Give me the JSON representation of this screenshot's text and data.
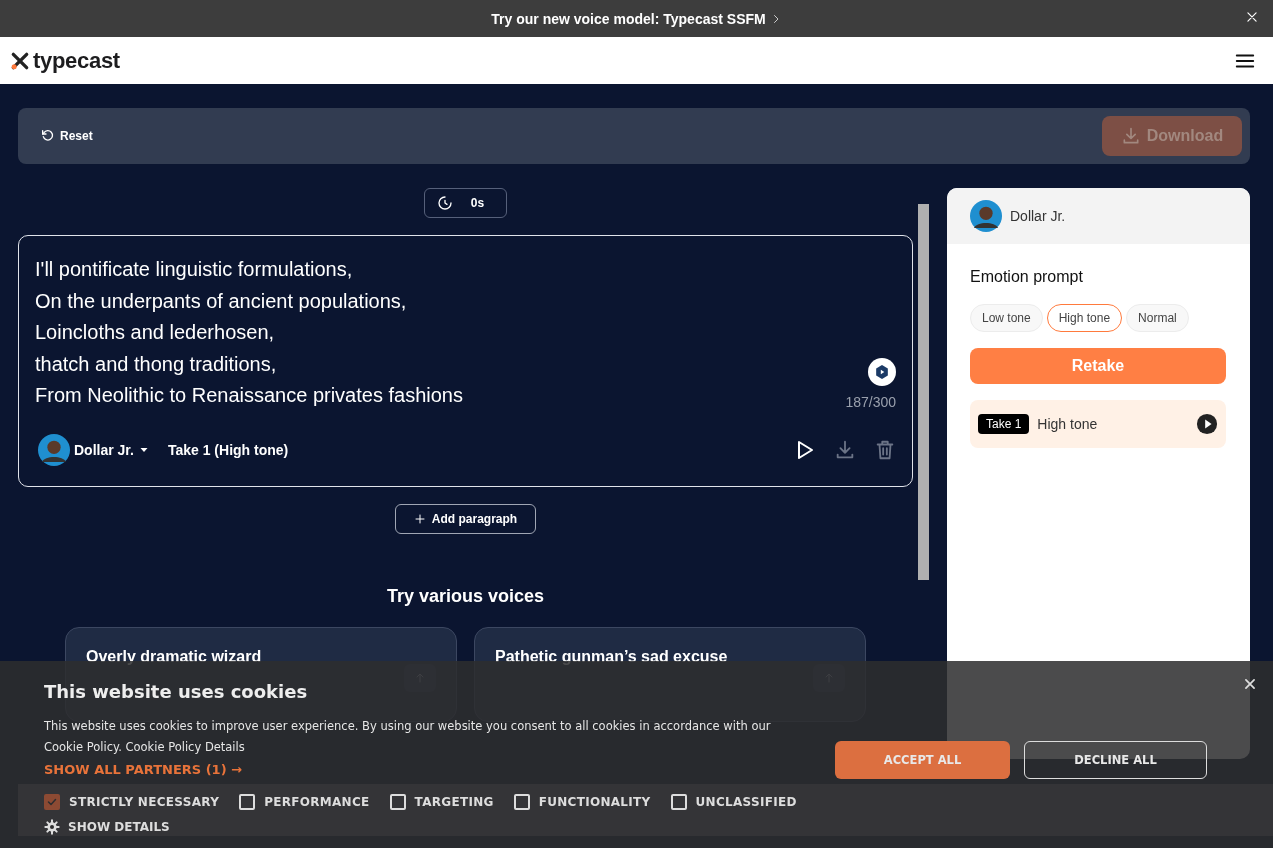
{
  "banner": {
    "text": "Try our new voice model: Typecast SSFM"
  },
  "header": {
    "logo": "typecast"
  },
  "toolbar": {
    "reset": "Reset",
    "download": {
      "label": "Download",
      "disabled": true
    }
  },
  "editor": {
    "timer": "0s",
    "lines": [
      "I'll pontificate linguistic formulations,",
      "On the underpants of ancient populations,",
      "Loincloths and lederhosen,",
      "thatch and thong traditions,",
      "From Neolithic to Renaissance privates fashions"
    ],
    "counter": "187/300",
    "voice": "Dollar Jr.",
    "take": "Take 1 (High tone)"
  },
  "add_paragraph": "Add paragraph",
  "voices": {
    "title": "Try various voices",
    "cards": [
      {
        "title": "Overly dramatic wizard"
      },
      {
        "title": "Pathetic gunman’s sad excuse"
      }
    ]
  },
  "side_panel": {
    "voice": "Dollar Jr.",
    "emotion_title": "Emotion prompt",
    "emotions": [
      {
        "label": "Low tone",
        "selected": false
      },
      {
        "label": "High tone",
        "selected": true
      },
      {
        "label": "Normal",
        "selected": false
      }
    ],
    "retake": "Retake",
    "takes": [
      {
        "badge": "Take 1",
        "label": "High tone"
      }
    ]
  },
  "cookies": {
    "title": "This website uses cookies",
    "body": "This website uses cookies to improve user experience. By using our website you consent to all cookies in accordance with our Cookie Policy.",
    "details_link": "Cookie Policy Details",
    "partners": "SHOW ALL PARTNERS (1) →",
    "accept": "ACCEPT ALL",
    "decline": "DECLINE ALL",
    "categories": [
      {
        "label": "STRICTLY NECESSARY",
        "checked": true
      },
      {
        "label": "PERFORMANCE",
        "checked": false
      },
      {
        "label": "TARGETING",
        "checked": false
      },
      {
        "label": "FUNCTIONALITY",
        "checked": false
      },
      {
        "label": "UNCLASSIFIED",
        "checked": false
      }
    ],
    "show_details": "SHOW DETAILS"
  }
}
